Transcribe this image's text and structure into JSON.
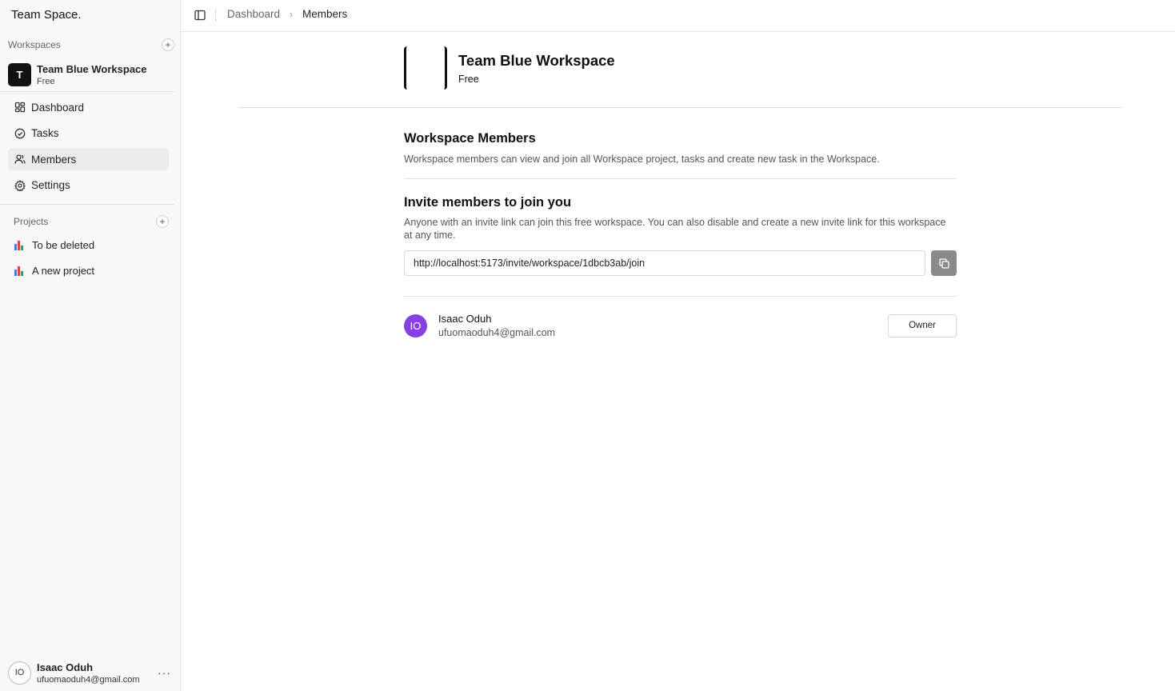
{
  "sidebar": {
    "brand": "Team Space.",
    "workspaces_heading": "Workspaces",
    "workspace": {
      "initial": "T",
      "name": "Team Blue Workspace",
      "plan": "Free"
    },
    "nav": [
      {
        "label": "Dashboard",
        "icon": "dashboard-icon"
      },
      {
        "label": "Tasks",
        "icon": "check-circle-icon"
      },
      {
        "label": "Members",
        "icon": "users-icon",
        "active": true
      },
      {
        "label": "Settings",
        "icon": "gear-icon"
      }
    ],
    "projects_heading": "Projects",
    "projects": [
      {
        "label": "To be deleted",
        "icon": "bar-chart-icon"
      },
      {
        "label": "A new project",
        "icon": "bar-chart-icon"
      }
    ],
    "user": {
      "initials": "IO",
      "name": "Isaac Oduh",
      "email": "ufuomaoduh4@gmail.com"
    }
  },
  "topbar": {
    "breadcrumb": {
      "parent": "Dashboard",
      "current": "Members"
    }
  },
  "workspace_header": {
    "name": "Team Blue Workspace",
    "plan": "Free"
  },
  "members_section": {
    "title": "Workspace Members",
    "description": "Workspace members can view and join all Workspace project, tasks and create new task in the Workspace."
  },
  "invite_section": {
    "title": "Invite members to join you",
    "description": "Anyone with an invite link can join this free workspace. You can also disable and create a new invite link for this workspace at any time.",
    "link": "http://localhost:5173/invite/workspace/1dbcb3ab/join"
  },
  "members": [
    {
      "initials": "IO",
      "name": "Isaac Oduh",
      "email": "ufuomaoduh4@gmail.com",
      "role": "Owner"
    }
  ],
  "colors": {
    "member_avatar": "#8a3ee8",
    "copy_button": "#8a8a8a",
    "sidebar_bg": "#f8f8f8",
    "active_nav_bg": "#ececec"
  }
}
